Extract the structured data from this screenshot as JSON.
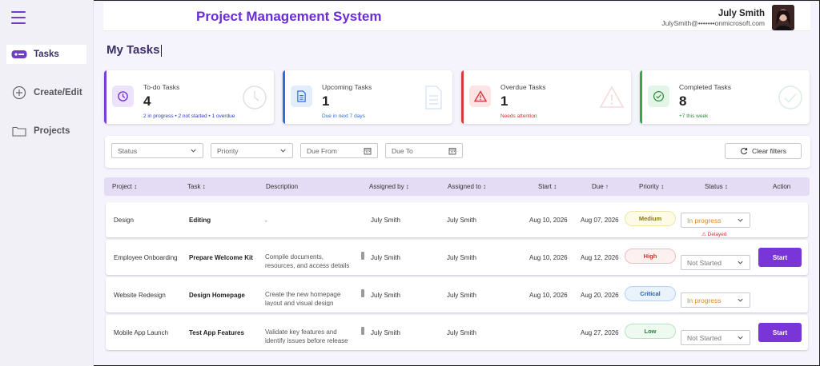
{
  "header": {
    "app_title": "Project Management System",
    "user_name": "July Smith",
    "user_email": "JulySmith@•••••••onmicrosoft.com"
  },
  "sidebar": {
    "items": [
      {
        "label": "Tasks",
        "icon": "tasks-icon",
        "active": true
      },
      {
        "label": "Create/Edit",
        "icon": "plus-circle-icon",
        "active": false
      },
      {
        "label": "Projects",
        "icon": "folder-icon",
        "active": false
      }
    ]
  },
  "page_title": "My Tasks",
  "cards": [
    {
      "label": "To-do Tasks",
      "count": "4",
      "sub": "2 in progress • 2 not started • 1 overdue",
      "color": "#7b3fd8",
      "sub_color": "#2f3bb8",
      "icon": "clock-icon"
    },
    {
      "label": "Upcoming Tasks",
      "count": "1",
      "sub": "Due in next 7 days",
      "color": "#2f6fd8",
      "sub_color": "#2f6fd8",
      "icon": "document-icon"
    },
    {
      "label": "Overdue Tasks",
      "count": "1",
      "sub": "Needs attention",
      "color": "#d83a3a",
      "sub_color": "#d32f2f",
      "icon": "warning-icon"
    },
    {
      "label": "Completed Tasks",
      "count": "8",
      "sub": "+7 this week",
      "color": "#2fa84f",
      "sub_color": "#2e8b3e",
      "icon": "check-circle-icon"
    }
  ],
  "filters": {
    "status_placeholder": "Status",
    "priority_placeholder": "Priority",
    "due_from_placeholder": "Due From",
    "due_to_placeholder": "Due To",
    "clear_label": "Clear filters"
  },
  "table": {
    "headers": {
      "project": "Project ↕",
      "task": "Task ↕",
      "description": "Description",
      "assigned_by": "Assigned by ↕",
      "assigned_to": "Assigned to ↕",
      "start": "Start ↕",
      "due": "Due ↑",
      "priority": "Priority ↕",
      "status": "Status ↕",
      "action": "Action"
    },
    "rows": [
      {
        "project": "Design",
        "task": "Editing",
        "description": "-",
        "assigned_by": "July Smith",
        "assigned_to": "July Smith",
        "start": "Aug 10, 2026",
        "due": "Aug 07, 2026",
        "priority": "Medium",
        "status": "In progress",
        "action": "",
        "note": "⚠ Delayed"
      },
      {
        "project": "Employee Onboarding",
        "task": "Prepare Welcome Kit",
        "description": "Compile documents, resources, and access details for new hires",
        "assigned_by": "July Smith",
        "assigned_to": "July Smith",
        "start": "Aug 10, 2026",
        "due": "Aug 12, 2026",
        "priority": "High",
        "status": "Not Started",
        "action": "Start",
        "note": ""
      },
      {
        "project": "Website Redesign",
        "task": "Design Homepage",
        "description": "Create the new homepage layout and visual design",
        "assigned_by": "July Smith",
        "assigned_to": "July Smith",
        "start": "Aug 10, 2026",
        "due": "Aug 20, 2026",
        "priority": "Critical",
        "status": "In progress",
        "action": "",
        "note": ""
      },
      {
        "project": "Mobile App Launch",
        "task": "Test App Features",
        "description": "Validate key features and identify issues before release",
        "assigned_by": "July Smith",
        "assigned_to": "July Smith",
        "start": "",
        "due": "Aug 27, 2026",
        "priority": "Low",
        "status": "Not Started",
        "action": "Start",
        "note": ""
      }
    ]
  },
  "priority_colors": {
    "Medium": {
      "bg": "#fdfbe6",
      "border": "#efe6a6",
      "text": "#8a7a10"
    },
    "High": {
      "bg": "#fdf0f0",
      "border": "#f2bcbc",
      "text": "#c0392b"
    },
    "Critical": {
      "bg": "#eaf3fc",
      "border": "#b7d3f0",
      "text": "#2b5fa8"
    },
    "Low": {
      "bg": "#eefaf0",
      "border": "#b9e3c0",
      "text": "#2e7d3a"
    }
  },
  "status_colors": {
    "In progress": "#e08a1e",
    "Not Started": "#777777"
  },
  "accent": "#7a35d8"
}
